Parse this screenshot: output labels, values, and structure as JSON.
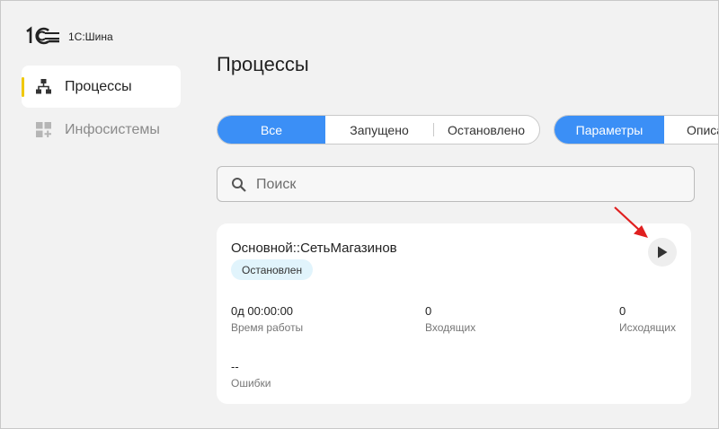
{
  "brand": {
    "name": "1С:Шина"
  },
  "sidebar": {
    "items": [
      {
        "label": "Процессы",
        "icon": "process-tree-icon",
        "active": true
      },
      {
        "label": "Инфосистемы",
        "icon": "infosystems-grid-icon",
        "active": false
      }
    ]
  },
  "main": {
    "title": "Процессы",
    "status_filter": {
      "options": [
        "Все",
        "Запущено",
        "Остановлено"
      ],
      "selected": "Все"
    },
    "view_switch": {
      "options": [
        "Параметры",
        "Описа"
      ],
      "selected": "Параметры"
    },
    "search": {
      "placeholder": "Поиск",
      "value": ""
    },
    "process_card": {
      "name": "Основной::СетьМагазинов",
      "status": "Остановлен",
      "metrics": [
        {
          "value": "0д 00:00:00",
          "label": "Время работы"
        },
        {
          "value": "0",
          "label": "Входящих"
        },
        {
          "value": "0",
          "label": "Исходящих"
        },
        {
          "value": "--",
          "label": "Ошибки"
        }
      ]
    }
  },
  "colors": {
    "accent": "#3b8ff6",
    "active_marker": "#f0c800",
    "badge_bg": "#e1f4fc",
    "annotation_arrow": "#e02020",
    "background": "#f2f2f2"
  }
}
